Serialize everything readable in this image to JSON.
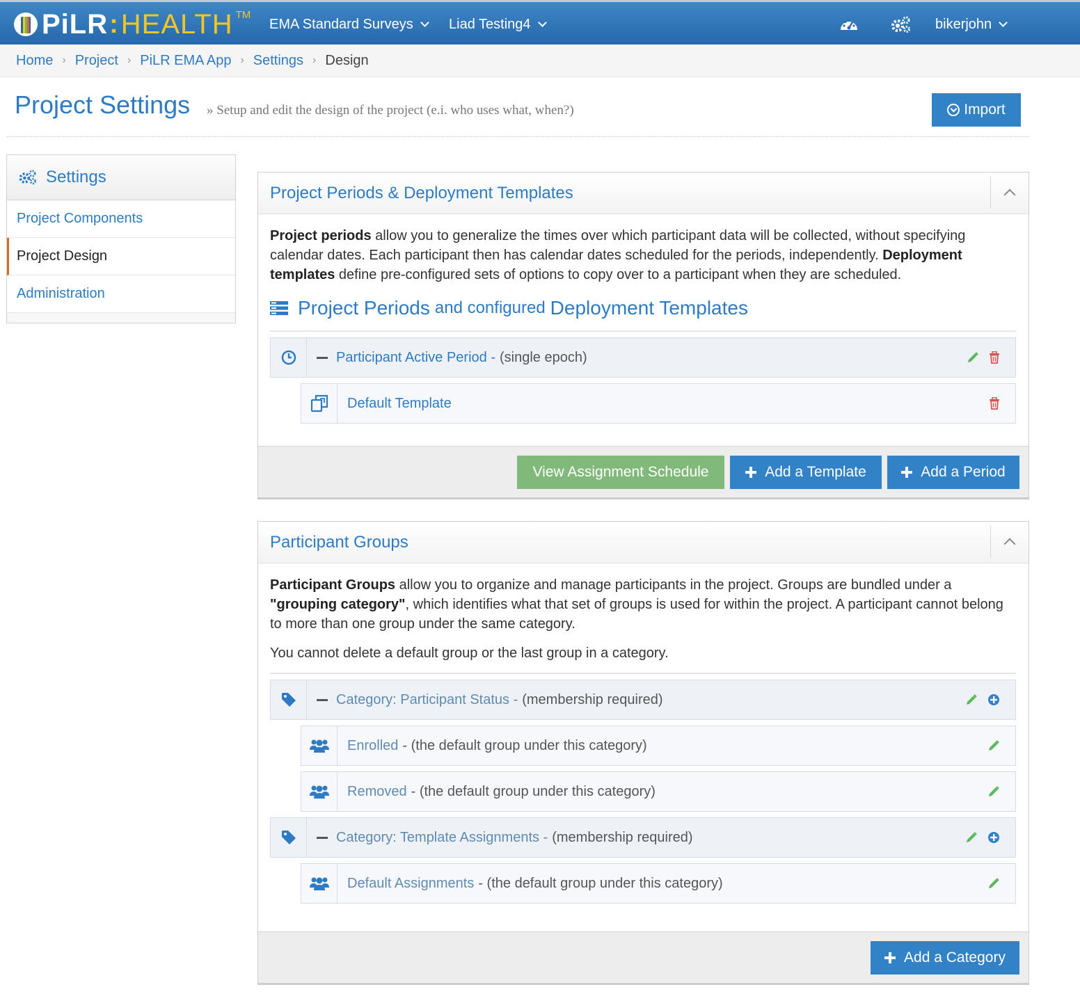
{
  "colors": {
    "primary": "#2e7bc4",
    "nav_bg": "#2e74b8",
    "green_button": "#80b97a",
    "blue_button": "#3282c8",
    "logo_accent": "#f3c623",
    "pencil": "#5cb85c",
    "trash": "#d9534f"
  },
  "brand": {
    "name_left": "PiLR",
    "name_right": "HEALTH",
    "trademark": "TM"
  },
  "topnav": {
    "project_menu": "EMA Standard Surveys",
    "study_menu": "Liad Testing4",
    "user_menu": "bikerjohn",
    "icons": [
      "dashboard-icon",
      "settings-gears-icon"
    ]
  },
  "breadcrumb": {
    "items": [
      "Home",
      "Project",
      "PiLR EMA App",
      "Settings"
    ],
    "current": "Design"
  },
  "header": {
    "title": "Project Settings",
    "subtitle": "» Setup and edit the design of the project (e.i. who uses what, when?)",
    "import_label": "Import"
  },
  "sidebar": {
    "title": "Settings",
    "items": [
      {
        "label": "Project Components",
        "active": false
      },
      {
        "label": "Project Design",
        "active": true
      },
      {
        "label": "Administration",
        "active": false
      }
    ]
  },
  "periods_panel": {
    "title": "Project Periods & Deployment Templates",
    "desc_bold1": "Project periods",
    "desc_text1": " allow you to generalize the times over which participant data will be collected, without specifying calendar dates. Each participant then has calendar dates scheduled for the periods, independently. ",
    "desc_bold2": "Deployment templates",
    "desc_text2": " define pre-configured sets of options to copy over to a participant when they are scheduled.",
    "section_part1": "Project Periods",
    "section_part2": "and configured",
    "section_part3": "Deployment Templates",
    "period": {
      "name": "Participant Active Period -",
      "note": "(single epoch)"
    },
    "template": {
      "name": "Default Template"
    },
    "buttons": {
      "view_schedule": "View Assignment Schedule",
      "add_template": "Add a Template",
      "add_period": "Add a Period"
    }
  },
  "groups_panel": {
    "title": "Participant Groups",
    "desc_bold1": "Participant Groups",
    "desc_text1": " allow you to organize and manage participants in the project. Groups are bundled under a ",
    "desc_bold2": "\"grouping category\"",
    "desc_text2": ", which identifies what that set of groups is used for within the project. A participant cannot belong to more than one group under the same category.",
    "desc_note": "You cannot delete a default group or the last group in a category.",
    "categories": [
      {
        "name": "Category: Participant Status -",
        "note": "(membership required)",
        "groups": [
          {
            "name": "Enrolled",
            "note": "- (the default group under this category)"
          },
          {
            "name": "Removed",
            "note": "- (the default group under this category)"
          }
        ]
      },
      {
        "name": "Category: Template Assignments -",
        "note": "(membership required)",
        "groups": [
          {
            "name": "Default Assignments",
            "note": "- (the default group under this category)"
          }
        ]
      }
    ],
    "buttons": {
      "add_category": "Add a Category"
    }
  }
}
